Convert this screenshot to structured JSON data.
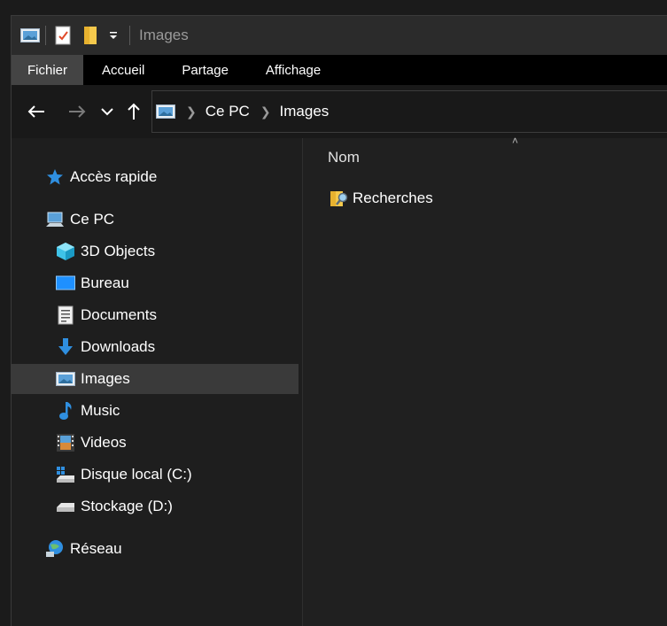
{
  "window": {
    "title": "Images"
  },
  "ribbon": {
    "tabs": [
      "Fichier",
      "Accueil",
      "Partage",
      "Affichage"
    ],
    "active": "Fichier"
  },
  "address": {
    "crumbs": [
      "Ce PC",
      "Images"
    ]
  },
  "sidebar": {
    "quick_access": "Accès rapide",
    "this_pc": "Ce PC",
    "items": [
      "3D Objects",
      "Bureau",
      "Documents",
      "Downloads",
      "Images",
      "Music",
      "Videos",
      "Disque local (C:)",
      "Stockage (D:)"
    ],
    "network": "Réseau",
    "selected": "Images"
  },
  "content": {
    "column_header": "Nom",
    "files": [
      {
        "name": "Recherches",
        "icon": "search-folder-icon"
      }
    ]
  },
  "colors": {
    "accent": "#1e90ff",
    "background": "#202020",
    "selection": "#3a3a3a"
  }
}
